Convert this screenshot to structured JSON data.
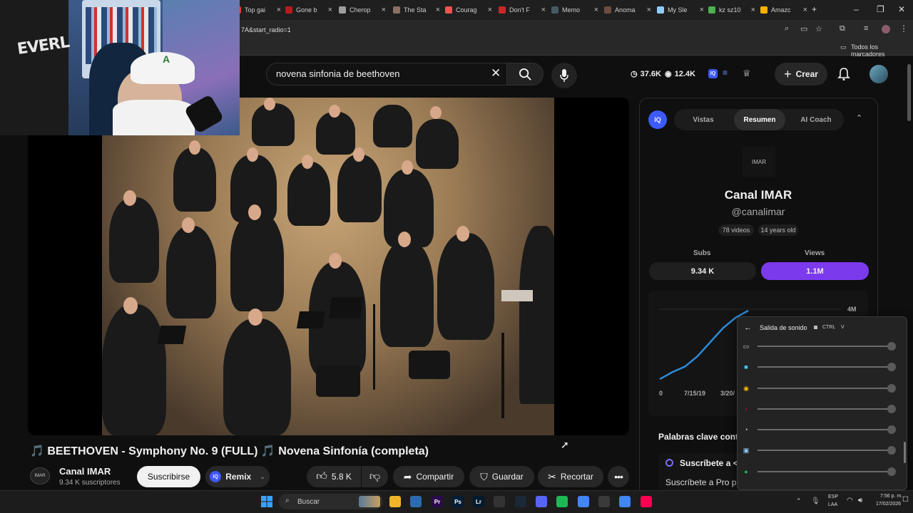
{
  "browser": {
    "tabs": [
      {
        "label": "Top gai",
        "color": "#e53935"
      },
      {
        "label": "Gone b",
        "color": "#b71c1c"
      },
      {
        "label": "Cherop",
        "color": "#9e9e9e"
      },
      {
        "label": "The Sta",
        "color": "#8d6e63"
      },
      {
        "label": "Courag",
        "color": "#ef5350"
      },
      {
        "label": "Don't F",
        "color": "#c62828"
      },
      {
        "label": "Memo",
        "color": "#455a64"
      },
      {
        "label": "Anoma",
        "color": "#6d4c41"
      },
      {
        "label": "My Sle",
        "color": "#90caf9"
      },
      {
        "label": "kz sz10",
        "color": "#4caf50"
      },
      {
        "label": "Amazc",
        "color": "#ffb300"
      }
    ],
    "url": "7A&start_radio=1",
    "bookmarks_label": "Todos los marcadores"
  },
  "header": {
    "search_query": "novena sinfonia de beethoven",
    "stat_views": "37.6K",
    "stat_eye": "12.4K",
    "create_label": "Crear"
  },
  "video": {
    "title": "🎵 BEETHOVEN - Symphony No. 9 (FULL) 🎵 Novena Sinfonía (completa)",
    "channel_name": "Canal IMAR",
    "channel_subs": "9.34 K suscriptores",
    "channel_logo_text": "IMAR",
    "subscribe_label": "Suscribirse",
    "remix_label": "Remix",
    "likes": "5.8 K",
    "share_label": "Compartir",
    "save_label": "Guardar",
    "clip_label": "Recortar"
  },
  "panel": {
    "badge": "IQ",
    "tabs": [
      "Vistas",
      "Resumen",
      "AI Coach"
    ],
    "active_tab": "Resumen",
    "logo_text": "IMAR",
    "channel_name": "Canal IMAR",
    "handle": "@canalimar",
    "videos_chip": "78 videos",
    "age_chip": "14 years old",
    "subs_label": "Subs",
    "views_label": "Views",
    "subs_value": "9.34 K",
    "views_value": "1.1M",
    "keywords_title": "Palabras clave contr",
    "keyword_item": "Suscríbete a <",
    "keyword_body": "Suscríbete a Pro p"
  },
  "chart_data": {
    "type": "line",
    "x_ticks": [
      "0",
      "7/15/19",
      "3/20/"
    ],
    "y_ticks": [
      "4M"
    ],
    "series": [
      {
        "values": [
          0.02,
          0.12,
          0.2,
          0.35,
          0.55,
          0.75,
          0.9,
          1.0
        ]
      }
    ],
    "color": "#2e8bd8"
  },
  "sound_popup": {
    "title": "Salida de sonido",
    "shortcut_mod": "CTRL",
    "shortcut_key": "V",
    "apps": [
      {
        "icon": "speaker-icon",
        "color": "#cccccc",
        "volume": 1.0
      },
      {
        "icon": "monitor-icon",
        "color": "#4fc3f7",
        "volume": 1.0
      },
      {
        "icon": "chrome-icon",
        "color": "#fbbc05",
        "volume": 1.0
      },
      {
        "icon": "tiktok-icon",
        "color": "#ff0050",
        "volume": 1.0
      },
      {
        "icon": "obs-icon",
        "color": "#dddddd",
        "volume": 1.0
      },
      {
        "icon": "window-icon",
        "color": "#90caf9",
        "volume": 1.0
      },
      {
        "icon": "spotify-icon",
        "color": "#1db954",
        "volume": 1.0
      }
    ]
  },
  "taskbar": {
    "search_label": "Buscar",
    "lang_top": "ESP",
    "lang_bottom": "LAA",
    "time": "7:56 p. m.",
    "date": "17/02/2026",
    "apps": [
      {
        "icon": "files-icon",
        "label": "",
        "color": "#f0b429"
      },
      {
        "icon": "app-icon",
        "label": "",
        "color": "#2b6cb0"
      },
      {
        "icon": "premiere-icon",
        "label": "Pr",
        "color": "#2a0a4a"
      },
      {
        "icon": "photoshop-icon",
        "label": "Ps",
        "color": "#001e36"
      },
      {
        "icon": "lightroom-icon",
        "label": "Lr",
        "color": "#001a2e"
      },
      {
        "icon": "epic-icon",
        "label": "",
        "color": "#333333"
      },
      {
        "icon": "steam-icon",
        "label": "",
        "color": "#1b2838"
      },
      {
        "icon": "discord-icon",
        "label": "",
        "color": "#5865f2"
      },
      {
        "icon": "spotify-icon",
        "label": "",
        "color": "#1db954"
      },
      {
        "icon": "chrome-icon",
        "label": "",
        "color": "#4285f4"
      },
      {
        "icon": "obs-icon",
        "label": "",
        "color": "#3a3a3a"
      },
      {
        "icon": "chrome-icon",
        "label": "",
        "color": "#4285f4"
      },
      {
        "icon": "tiktok-icon",
        "label": "",
        "color": "#ff0050"
      }
    ]
  }
}
